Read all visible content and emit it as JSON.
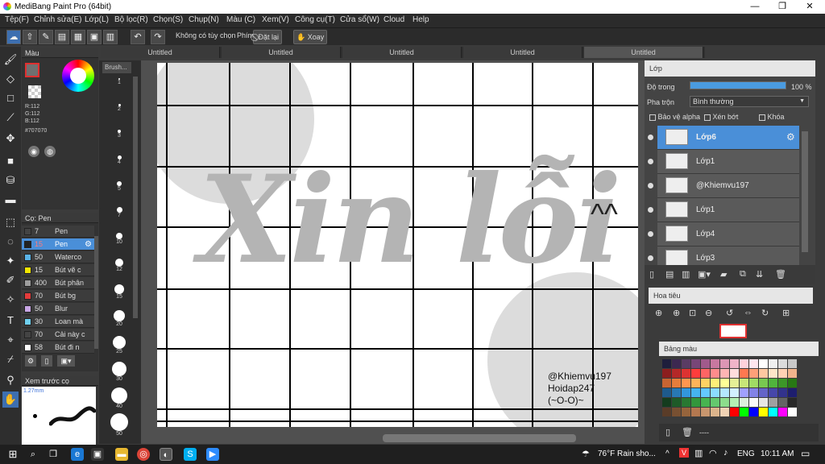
{
  "window": {
    "title": "MediBang Paint Pro (64bit)",
    "minimize": "—",
    "maximize": "❐",
    "close": "✕"
  },
  "menu": [
    "Tệp(F)",
    "Chỉnh sửa(E)",
    "Lớp(L)",
    "Bộ lọc(R)",
    "Chọn(S)",
    "Chụp(N)",
    "Màu (C)",
    "Xem(V)",
    "Công cụ(T)",
    "Cửa sổ(W)",
    "Cloud",
    "Help"
  ],
  "toolbar": {
    "no_option": "Không có tùy chọn",
    "key_label": "Phím",
    "reset": "Đặt lại",
    "rotate": "Xoay"
  },
  "tabs": [
    "Untitled",
    "Untitled",
    "Untitled",
    "Untitled",
    "Untitled"
  ],
  "color_panel": {
    "title": "Màu",
    "r": "R:112",
    "g": "G:112",
    "b": "B:112",
    "hex": "#707070",
    "fg_color": "#707070"
  },
  "brush_panel": {
    "title": "Cọ: Pen",
    "items": [
      {
        "size": "7",
        "name": "Pen",
        "color": "#444444"
      },
      {
        "size": "15",
        "name": "Pen",
        "color": "#222222"
      },
      {
        "size": "50",
        "name": "Waterco",
        "color": "#5ab4e8"
      },
      {
        "size": "15",
        "name": "Bút vẽ c",
        "color": "#f2e600"
      },
      {
        "size": "400",
        "name": "Bút phân",
        "color": "#9d9d9d"
      },
      {
        "size": "70",
        "name": "Bút bg",
        "color": "#e33b3b"
      },
      {
        "size": "50",
        "name": "Blur",
        "color": "#c9a7e6"
      },
      {
        "size": "30",
        "name": "Loan mà",
        "color": "#6fd0f0"
      },
      {
        "size": "70",
        "name": "Cải này c",
        "color": "#444444"
      },
      {
        "size": "58",
        "name": "Bút đi n",
        "color": "#ffffff"
      }
    ]
  },
  "preview": {
    "title": "Xem trước cọ",
    "size": "1.27mm"
  },
  "brush_sizes": {
    "title": "Brush...",
    "labels": [
      "1",
      "2",
      "3",
      "4",
      "5",
      "7",
      "10",
      "12",
      "15",
      "20",
      "25",
      "30",
      "40",
      "50"
    ]
  },
  "canvas": {
    "text_main": "Xin lỗi",
    "text_tail": "^^",
    "signature": [
      "@Khiemvu197",
      "Hoidap247",
      "(~O-O)~"
    ]
  },
  "layers": {
    "title": "Lớp",
    "opacity_label": "Độ trong",
    "opacity_value": "100 %",
    "opacity": 1.0,
    "blend_label": "Pha trộn",
    "blend_value": "Bình thường",
    "protect_alpha": "Bảo vệ alpha",
    "clipping": "Xén bớt",
    "lock": "Khóa",
    "items": [
      {
        "name": "Lớp6",
        "selected": true
      },
      {
        "name": "Lớp1"
      },
      {
        "name": "@Khiemvu197"
      },
      {
        "name": "Lớp1"
      },
      {
        "name": "Lớp4"
      },
      {
        "name": "Lớp3"
      }
    ]
  },
  "navigator": {
    "title": "Hoa tiêu"
  },
  "palette": {
    "title": "Bảng màu",
    "footer": "----",
    "colors": [
      "#1e1e3c",
      "#3c2850",
      "#5a3c64",
      "#784678",
      "#a05a8c",
      "#c878a0",
      "#dc96b4",
      "#f0b4c8",
      "#ffd2dc",
      "#ffe6ee",
      "#ffffff",
      "#f0f0f0",
      "#dcdcdc",
      "#c8c8c8",
      "#8c1e1e",
      "#b42828",
      "#dc3232",
      "#ff3c3c",
      "#ff6464",
      "#ff8c8c",
      "#ffb4b4",
      "#ffdcdc",
      "#ff7850",
      "#ffa078",
      "#ffc8a0",
      "#ffe6c8",
      "#ffd2b4",
      "#f0b48c",
      "#c86432",
      "#e67d3c",
      "#ff9650",
      "#ffb45a",
      "#ffd264",
      "#fff078",
      "#ffff96",
      "#e6f096",
      "#c8e678",
      "#a0dc64",
      "#78c850",
      "#50b43c",
      "#3c9628",
      "#287814",
      "#1e5a8c",
      "#2878b4",
      "#3296dc",
      "#46b4f0",
      "#64c8ff",
      "#8cdcff",
      "#b4e6ff",
      "#d2f0ff",
      "#a0a0ff",
      "#8282e6",
      "#6464c8",
      "#4646aa",
      "#32328c",
      "#1e1e6e",
      "#143c1e",
      "#1e5a28",
      "#287832",
      "#32963c",
      "#46b450",
      "#64c86e",
      "#8cdc8c",
      "#b4f0b4",
      "#dcf0dc",
      "#fafafa",
      "#e6e6e6",
      "#a0a0a0",
      "#646464",
      "#282828",
      "#5a3c28",
      "#785032",
      "#96643c",
      "#b47850",
      "#c8966e",
      "#dcb48c",
      "#f0d2b4",
      "#ff0000",
      "#00ff00",
      "#0000ff",
      "#ffff00",
      "#00ffff",
      "#ff00ff",
      "#ffffff"
    ]
  },
  "taskbar": {
    "weather": "76°F  Rain sho...",
    "lang": "ENG",
    "time": "10:11 AM"
  }
}
